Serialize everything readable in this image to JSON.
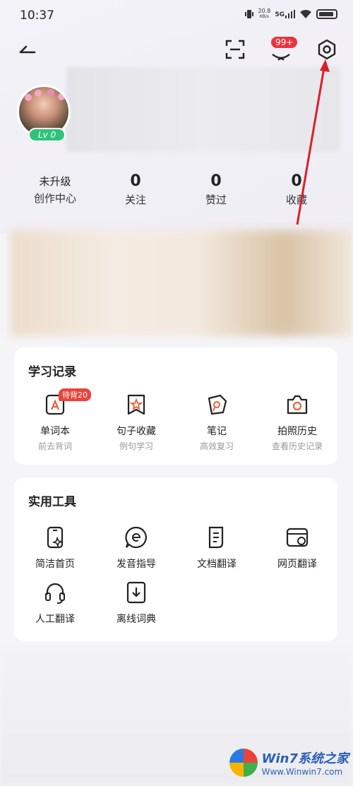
{
  "status_bar": {
    "time": "10:37",
    "net_speed": "20.8",
    "net_unit": "KB/s",
    "network": "5G"
  },
  "header": {
    "back_icon": "back-arrow-icon",
    "scan_icon": "scan-icon",
    "message_badge": "99+",
    "settings_icon": "settings-icon"
  },
  "profile": {
    "level": "Lv 0"
  },
  "stats": {
    "creator_top": "未升级",
    "creator_bottom": "创作中心",
    "follow_count": "0",
    "follow_label": "关注",
    "liked_count": "0",
    "liked_label": "赞过",
    "favorite_count": "0",
    "favorite_label": "收藏"
  },
  "study": {
    "title": "学习记录",
    "items": [
      {
        "name": "单词本",
        "sub": "前去背词",
        "tag": "待背20",
        "icon": "wordbook-icon"
      },
      {
        "name": "句子收藏",
        "sub": "例句学习",
        "icon": "sentence-fav-icon"
      },
      {
        "name": "笔记",
        "sub": "高效复习",
        "icon": "notes-icon"
      },
      {
        "name": "拍照历史",
        "sub": "查看历史记录",
        "icon": "camera-icon"
      }
    ]
  },
  "tools": {
    "title": "实用工具",
    "items": [
      {
        "name": "简洁首页",
        "icon": "simple-home-icon"
      },
      {
        "name": "发音指导",
        "icon": "pronunciation-icon"
      },
      {
        "name": "文档翻译",
        "icon": "doc-translate-icon"
      },
      {
        "name": "网页翻译",
        "icon": "web-translate-icon"
      },
      {
        "name": "人工翻译",
        "icon": "human-translate-icon"
      },
      {
        "name": "离线词典",
        "icon": "offline-dict-icon"
      }
    ]
  },
  "watermark": {
    "title": "Win7系统之家",
    "url": "Www.Winwin7.com"
  },
  "colors": {
    "accent_red": "#e8343f",
    "level_green": "#2ec27a",
    "icon_orange": "#e8643c"
  }
}
